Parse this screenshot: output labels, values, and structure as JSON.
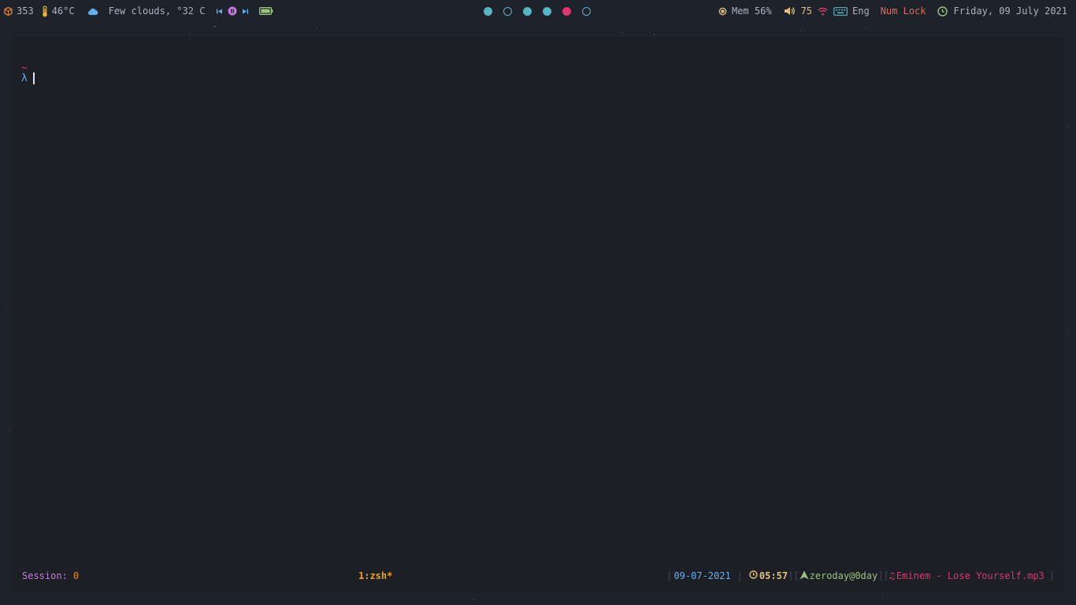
{
  "topbar": {
    "packages_count": "353",
    "cpu_temp": "46°C",
    "weather": "Few clouds, °32 C",
    "memory": "Mem 56%",
    "volume": "75",
    "keyboard_layout": "Eng",
    "num_lock": "Num Lock",
    "datetime": "Friday, 09 July 2021",
    "icons": {
      "packages": "package-icon",
      "temperature": "thermometer-icon",
      "weather": "cloud-icon",
      "media_prev": "skip-previous-icon",
      "media_play": "play-pause-icon",
      "media_next": "skip-next-icon",
      "battery": "battery-icon",
      "memory": "memory-chip-icon",
      "volume": "volume-icon",
      "wifi": "wifi-icon",
      "keyboard": "keyboard-icon",
      "clock": "clock-icon"
    },
    "workspaces": [
      {
        "state": "occupied"
      },
      {
        "state": "empty"
      },
      {
        "state": "occupied"
      },
      {
        "state": "occupied"
      },
      {
        "state": "urgent"
      },
      {
        "state": "empty"
      }
    ]
  },
  "terminal": {
    "cwd": "~",
    "prompt_symbol": "λ",
    "status": {
      "session_label": "Session: ",
      "session_number": "0",
      "window": "1:zsh*",
      "date": "09-07-2021",
      "time": "05:57",
      "user_host": "zeroday@0day",
      "now_playing": "Eminem - Lose Yourself.mp3",
      "bracket_open": "[",
      "bracket_close": "]",
      "separator": "|"
    }
  },
  "colors": {
    "background": "#1e222a",
    "terminal_bg": "#1c1f25",
    "accent_cyan": "#56b6c2",
    "accent_pink": "#e0356c",
    "accent_orange": "#f0a020",
    "accent_green": "#98c379",
    "accent_blue": "#61afef",
    "accent_purple": "#c678dd"
  }
}
